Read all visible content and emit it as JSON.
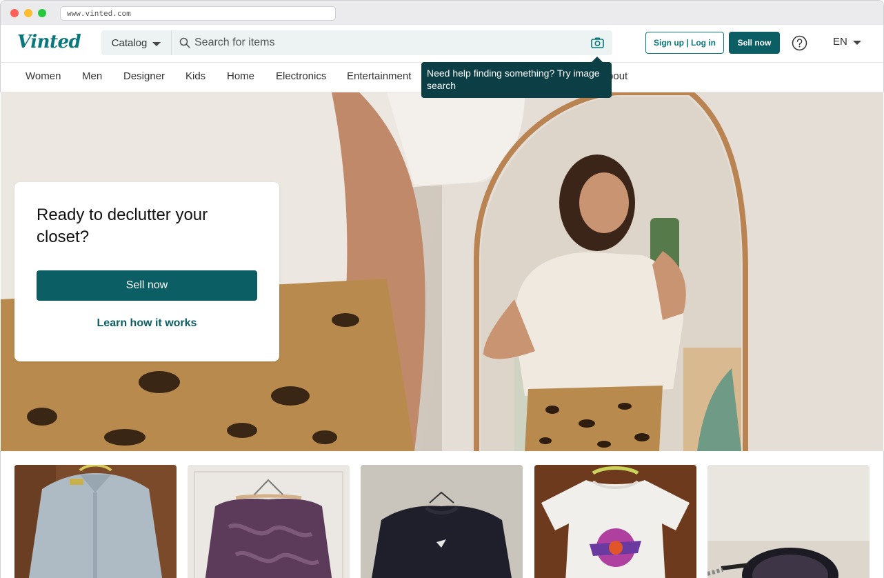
{
  "browser": {
    "url": "www.vinted.com"
  },
  "header": {
    "logo": "Vinted",
    "catalog_label": "Catalog",
    "search_placeholder": "Search for items",
    "signup_label": "Sign up | Log in",
    "sell_now_label": "Sell now",
    "language": "EN"
  },
  "nav": {
    "items": [
      "Women",
      "Men",
      "Designer",
      "Kids",
      "Home",
      "Electronics",
      "Entertainment",
      "About"
    ]
  },
  "tooltip": {
    "text": "Need help finding something? Try image search"
  },
  "hero": {
    "title": "Ready to declutter your closet?",
    "sell_now_label": "Sell now",
    "learn_label": "Learn how it works"
  },
  "items": [
    {
      "name": "polo-shirt"
    },
    {
      "name": "purple-blouse"
    },
    {
      "name": "black-sweatshirt"
    },
    {
      "name": "graphic-tshirt"
    },
    {
      "name": "sunglasses"
    }
  ],
  "colors": {
    "brand": "#09777c",
    "primary_button": "#0b5e64",
    "tooltip_bg": "#0c3e46"
  }
}
